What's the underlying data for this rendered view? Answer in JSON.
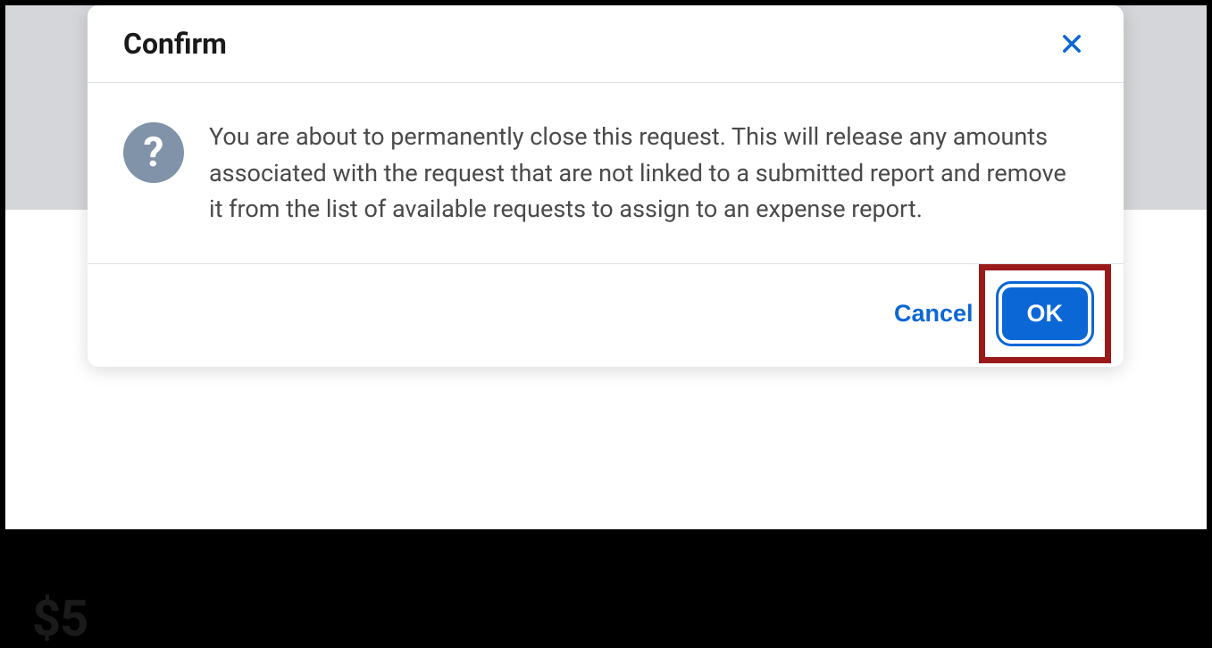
{
  "background": {
    "amount_partial": "$5"
  },
  "dialog": {
    "title": "Confirm",
    "message": "You are about to permanently close this request. This will release any amounts associated with the request that are not linked to a submitted report and remove it from the list of available requests to assign to an expense report.",
    "cancel_label": "Cancel",
    "ok_label": "OK"
  }
}
